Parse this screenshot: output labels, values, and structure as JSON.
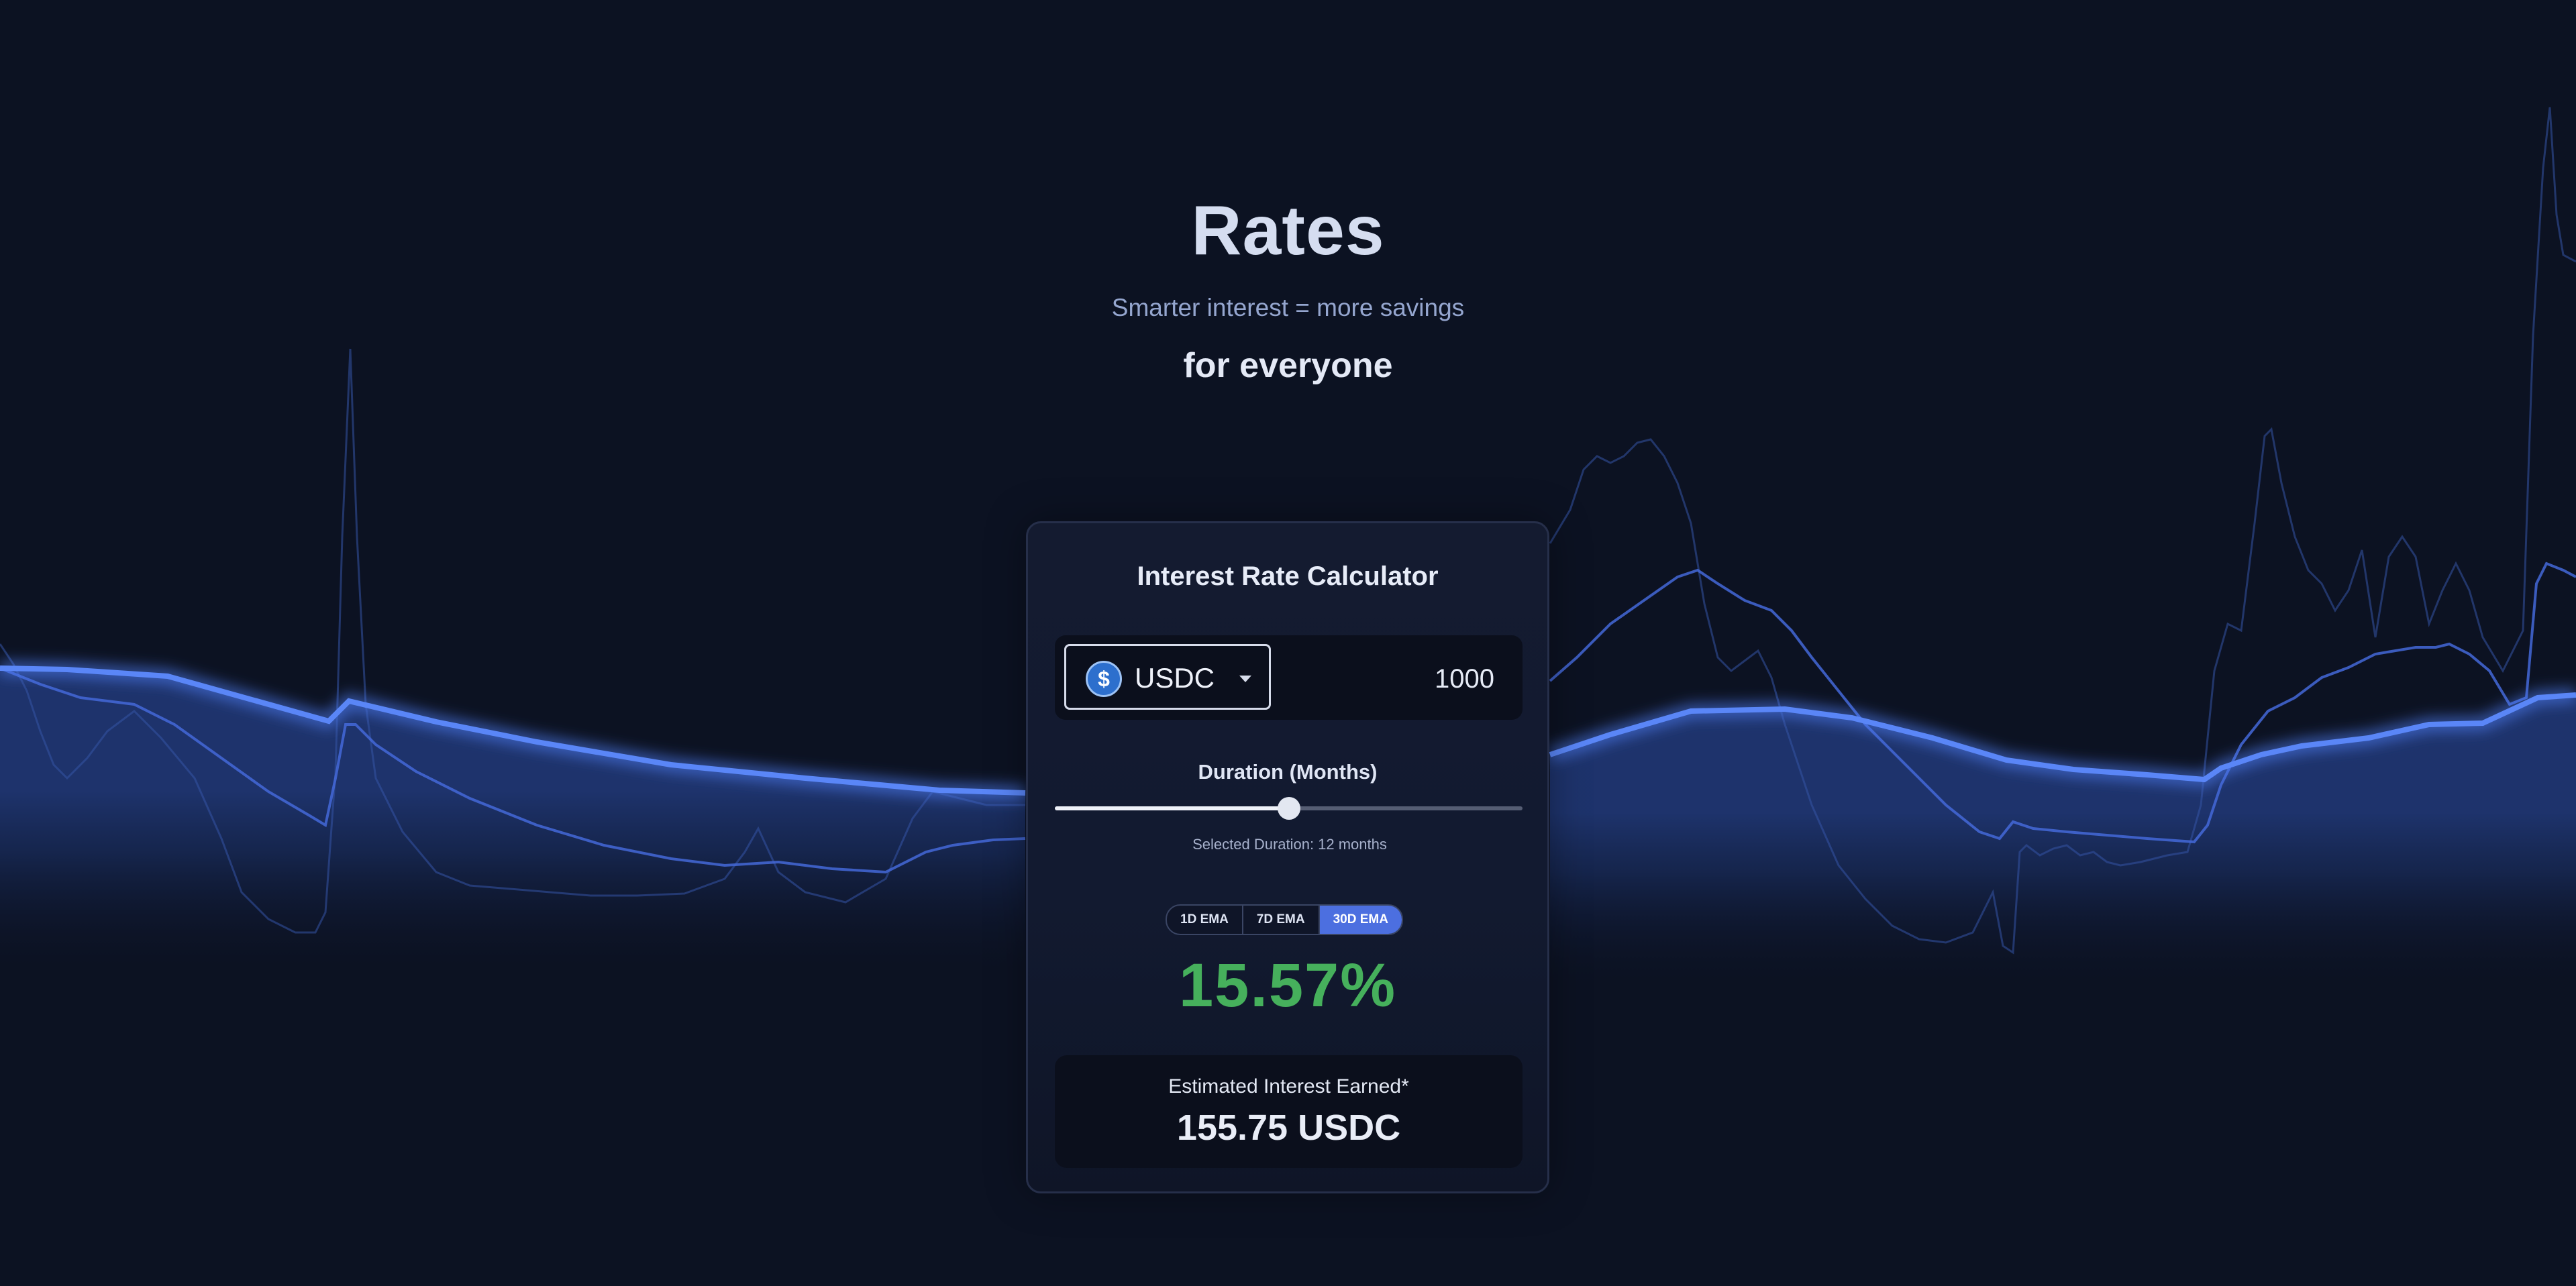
{
  "hero": {
    "title": "Rates",
    "subtitle": "Smarter interest = more savings",
    "tagline": "for everyone"
  },
  "calculator": {
    "title": "Interest Rate Calculator",
    "currency": {
      "selected": "USDC",
      "icon": "usdc-coin-icon",
      "icon_glyph": "$"
    },
    "amount": "1000",
    "duration": {
      "label": "Duration (Months)",
      "selected_text": "Selected Duration:",
      "selected_value": "12 months",
      "months": 12,
      "max_months": 24
    },
    "ema_tabs": [
      {
        "label": "1D EMA",
        "active": false
      },
      {
        "label": "7D EMA",
        "active": false
      },
      {
        "label": "30D EMA",
        "active": true
      }
    ],
    "rate": "15.57%",
    "estimate": {
      "label": "Estimated Interest Earned*",
      "value": "155.75 USDC"
    }
  },
  "colors": {
    "background": "#0c1222",
    "accent": "#4c6fe0",
    "line": "#4d7cf0",
    "rate_green": "#46b05c"
  }
}
